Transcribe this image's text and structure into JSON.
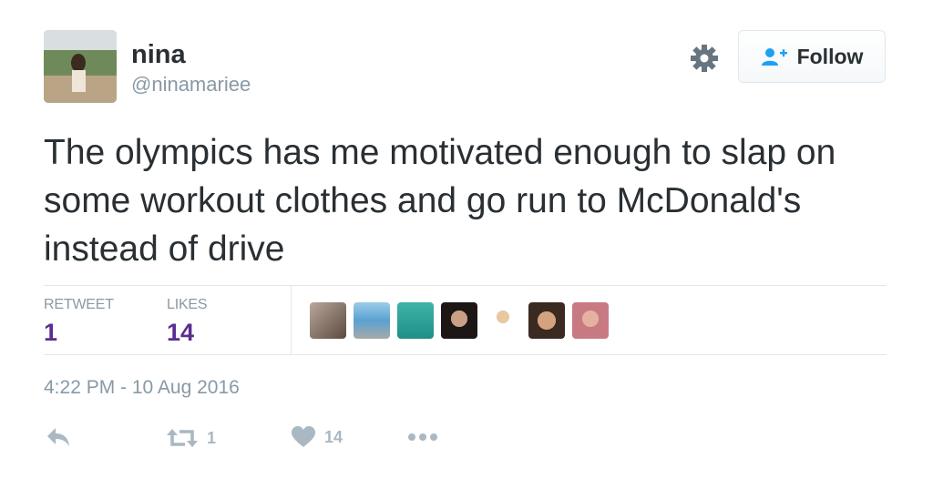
{
  "user": {
    "name": "nina",
    "handle": "@ninamariee"
  },
  "header": {
    "follow_label": "Follow"
  },
  "tweet": {
    "text": "The olympics has me motivated enough to slap on some workout clothes and go run to McDonald's instead of drive",
    "timestamp": "4:22 PM - 10 Aug 2016"
  },
  "stats": {
    "retweets_label": "RETWEET",
    "retweets_value": "1",
    "likes_label": "LIKES",
    "likes_value": "14"
  },
  "actions": {
    "retweet_count": "1",
    "like_count": "14"
  },
  "colors": {
    "count_purple": "#5c2d91",
    "muted_gray": "#8899a6",
    "icon_gray": "#aab8c2",
    "follow_blue": "#1da1f2"
  },
  "icons": [
    "gear-icon",
    "follow-person-icon",
    "reply-icon",
    "retweet-icon",
    "heart-icon",
    "more-icon"
  ]
}
